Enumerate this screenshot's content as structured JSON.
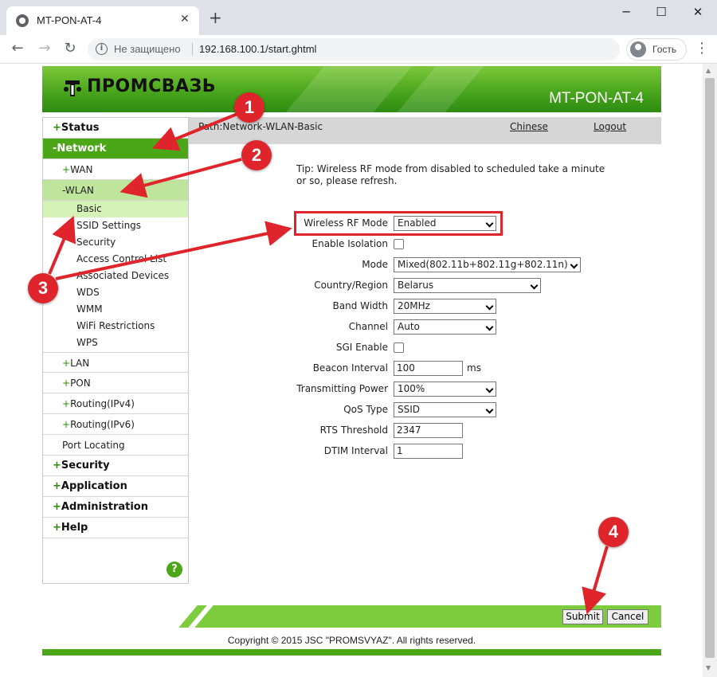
{
  "browser": {
    "tab_title": "MT-PON-AT-4",
    "tab_close": "✕",
    "new_tab": "+",
    "not_secure": "Не защищено",
    "url": "192.168.100.1/start.ghtml",
    "guest": "Гость",
    "win_min": "─",
    "win_max": "☐",
    "win_close": "✕",
    "back": "←",
    "forward": "→",
    "reload": "↻",
    "menu": "⋮"
  },
  "header": {
    "logo": "ПРОМСВАЗЬ",
    "model": "MT-PON-AT-4"
  },
  "path": {
    "text": "Path:Network-WLAN-Basic",
    "chinese": "Chinese",
    "logout": "Logout"
  },
  "sidebar": {
    "status": {
      "sign": "+",
      "label": "Status"
    },
    "network": {
      "sign": "-",
      "label": "Network"
    },
    "wan": {
      "sign": "+",
      "label": "WAN"
    },
    "wlan": {
      "sign": "-",
      "label": "WLAN"
    },
    "wlan_items": [
      "Basic",
      "SSID Settings",
      "Security",
      "Access Control List",
      "Associated Devices",
      "WDS",
      "WMM",
      "WiFi Restrictions",
      "WPS"
    ],
    "lan": {
      "sign": "+",
      "label": "LAN"
    },
    "pon": {
      "sign": "+",
      "label": "PON"
    },
    "routing4": {
      "sign": "+",
      "label": "Routing(IPv4)"
    },
    "routing6": {
      "sign": "+",
      "label": "Routing(IPv6)"
    },
    "port_locating": "Port Locating",
    "security": {
      "sign": "+",
      "label": "Security"
    },
    "application": {
      "sign": "+",
      "label": "Application"
    },
    "administration": {
      "sign": "+",
      "label": "Administration"
    },
    "help": {
      "sign": "+",
      "label": "Help"
    },
    "help_icon": "?"
  },
  "tip": "Tip: Wireless RF mode from disabled to scheduled take a minute or so, please refresh.",
  "form": {
    "rf_mode": {
      "label": "Wireless RF Mode",
      "value": "Enabled"
    },
    "isolation": {
      "label": "Enable Isolation",
      "checked": false
    },
    "mode": {
      "label": "Mode",
      "value": "Mixed(802.11b+802.11g+802.11n)"
    },
    "country": {
      "label": "Country/Region",
      "value": "Belarus"
    },
    "bandwidth": {
      "label": "Band Width",
      "value": "20MHz"
    },
    "channel": {
      "label": "Channel",
      "value": "Auto"
    },
    "sgi": {
      "label": "SGI Enable",
      "checked": false
    },
    "beacon": {
      "label": "Beacon Interval",
      "value": "100",
      "unit": "ms"
    },
    "power": {
      "label": "Transmitting Power",
      "value": "100%"
    },
    "qos": {
      "label": "QoS Type",
      "value": "SSID"
    },
    "rts": {
      "label": "RTS Threshold",
      "value": "2347"
    },
    "dtim": {
      "label": "DTIM Interval",
      "value": "1"
    }
  },
  "buttons": {
    "submit": "Submit",
    "cancel": "Cancel"
  },
  "copyright": "Copyright © 2015 JSC \"PROMSVYAZ\". All rights reserved.",
  "annotations": [
    "1",
    "2",
    "3",
    "4"
  ],
  "colors": {
    "brand_green": "#4ba718",
    "annotation_red": "#e0242b"
  }
}
